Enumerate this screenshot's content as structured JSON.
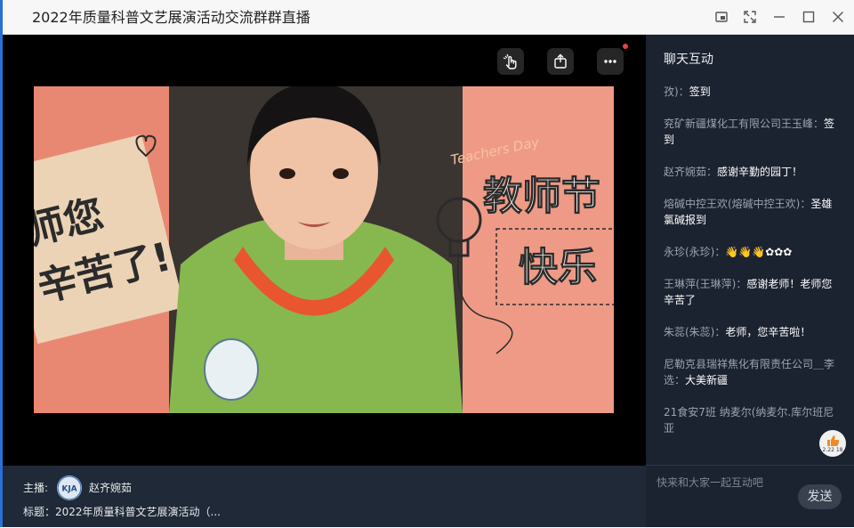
{
  "window": {
    "title": "2022年质量科普文艺展演活动交流群群直播"
  },
  "video": {
    "overlay_text_1": "师您",
    "overlay_text_2": "辛苦了!",
    "banner_text": "Teachers Day",
    "title_line_1": "教师节",
    "title_line_2": "快乐"
  },
  "host": {
    "label": "主播:",
    "avatar_text": "KJA",
    "name": "赵齐婉茹",
    "topic": "标题：2022年质量科普文艺展演活动（..."
  },
  "chat": {
    "title": "聊天互动",
    "messages": [
      {
        "name": "孜)：",
        "text": "签到"
      },
      {
        "name": "兖矿新疆煤化工有限公司王玉峰：",
        "text": "签到"
      },
      {
        "name": "赵齐婉茹：",
        "text": "感谢辛勤的园丁！"
      },
      {
        "name": "熔碱中控王欢(熔碱中控王欢)：",
        "text": "圣雄氯碱报到"
      },
      {
        "name": "永珍(永珍)：",
        "text": "👋👋👋✿✿✿"
      },
      {
        "name": "王琳萍(王琳萍)：",
        "text": "感谢老师！老师您辛苦了"
      },
      {
        "name": "朱蕊(朱蕊)：",
        "text": "老师，您辛苦啦！"
      },
      {
        "name": "尼勒克县瑞祥焦化有限责任公司＿李选：",
        "text": "大美新疆"
      },
      {
        "name": "21食安7班 纳麦尔(纳麦尔.库尔班尼亚",
        "text": ""
      }
    ],
    "like_count": "2.22 18",
    "input_placeholder": "快来和大家一起互动吧",
    "send_label": "发送"
  }
}
